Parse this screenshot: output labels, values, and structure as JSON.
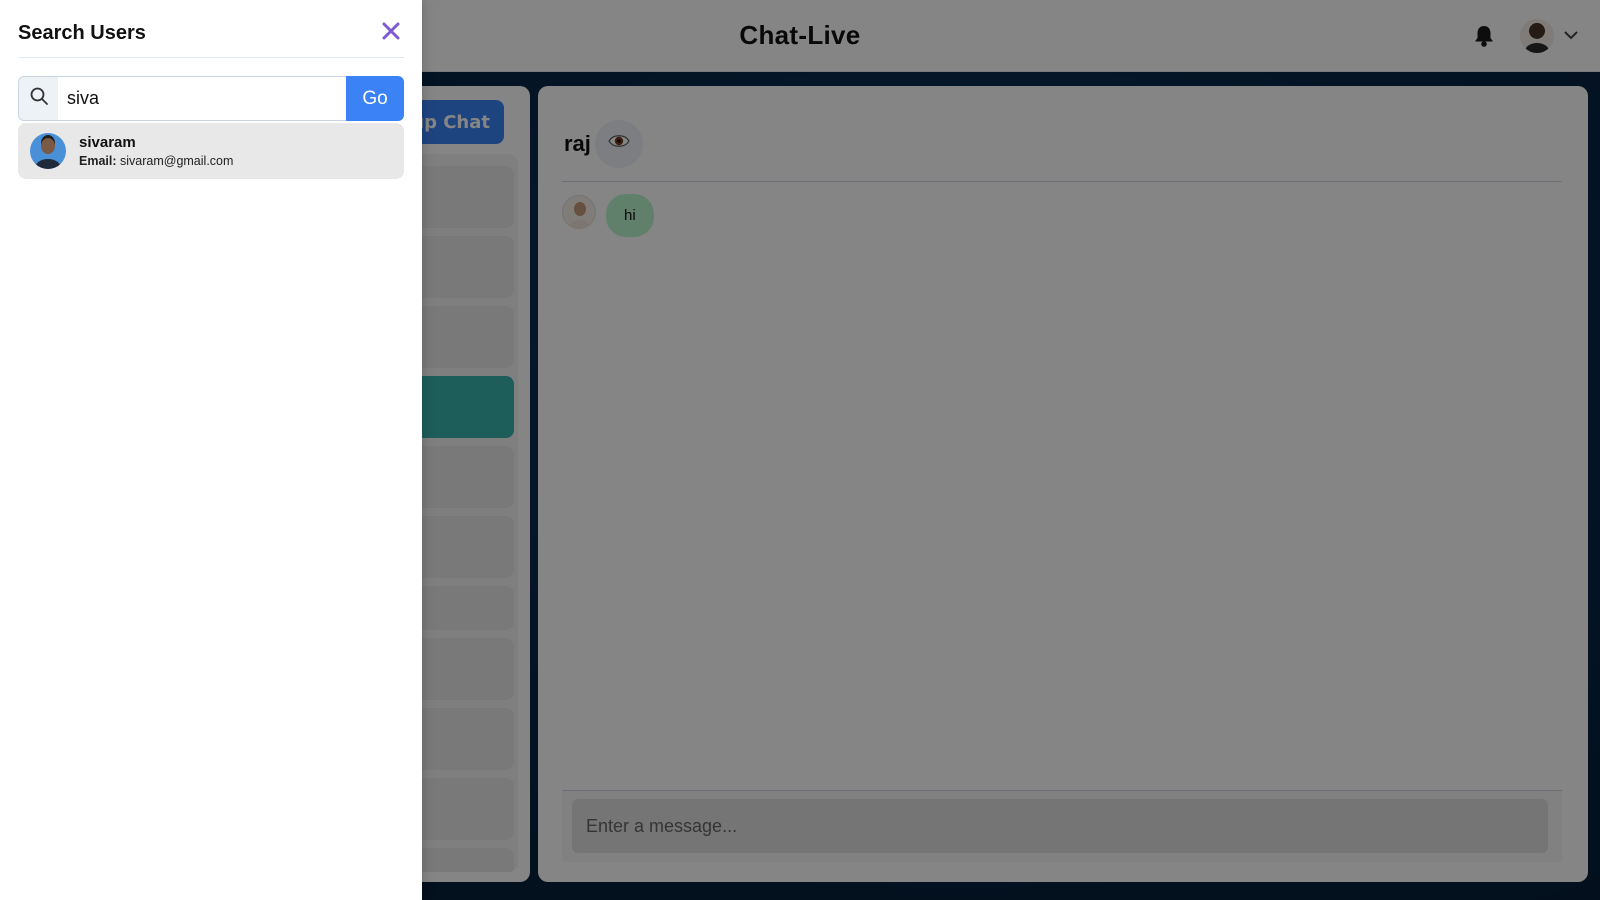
{
  "app": {
    "title": "Chat-Live"
  },
  "header": {
    "notification_icon": "bell-icon",
    "profile_icon": "chevron-down-icon"
  },
  "chats_panel": {
    "new_group_button_label": "New Group Chat"
  },
  "chat": {
    "contact_name": "raj",
    "view_icon": "eye-icon",
    "messages": [
      {
        "text": "hi"
      }
    ],
    "input_placeholder": "Enter a message..."
  },
  "search_drawer": {
    "title": "Search Users",
    "close_icon": "close-icon",
    "search_icon": "search-icon",
    "query": "siva",
    "go_label": "Go",
    "results": [
      {
        "name": "sivaram",
        "email_label": "Email:",
        "email": "sivaram@gmail.com"
      }
    ]
  },
  "colors": {
    "accent": "#3b82f6",
    "selected_chat": "#38b2ac",
    "close_icon": "#805ad5",
    "message_bubble": "#b9f5d0"
  }
}
